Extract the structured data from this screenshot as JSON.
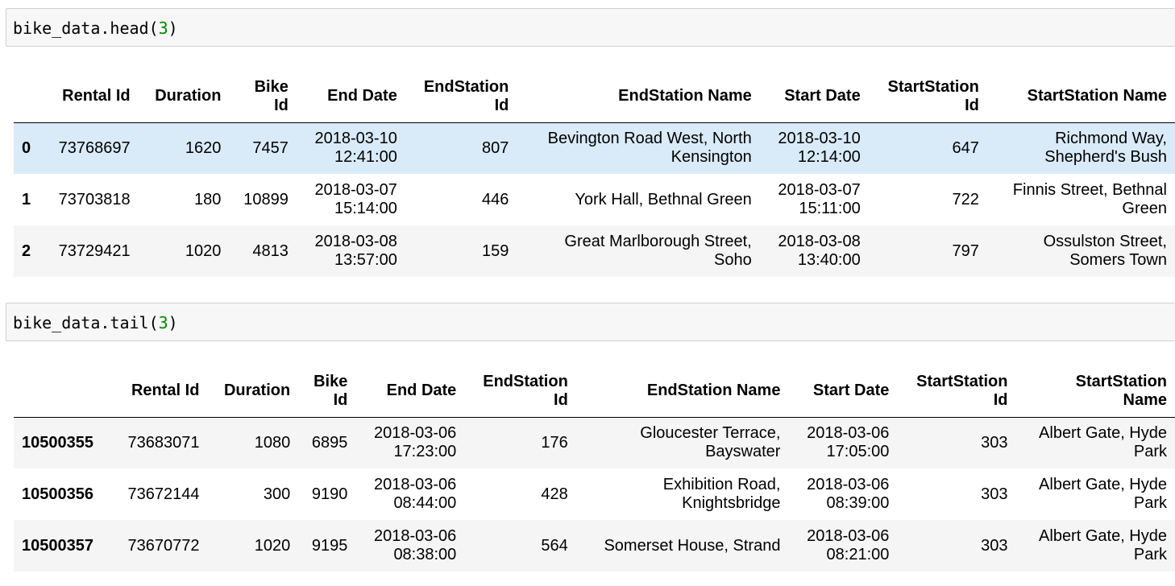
{
  "cells": [
    {
      "code_prefix": "bike_data.head(",
      "code_arg": "3",
      "code_suffix": ")",
      "columns": [
        {
          "l1": "Rental Id",
          "l2": ""
        },
        {
          "l1": "Duration",
          "l2": ""
        },
        {
          "l1": "Bike",
          "l2": "Id"
        },
        {
          "l1": "End Date",
          "l2": ""
        },
        {
          "l1": "EndStation",
          "l2": "Id"
        },
        {
          "l1": "EndStation Name",
          "l2": ""
        },
        {
          "l1": "Start Date",
          "l2": ""
        },
        {
          "l1": "StartStation",
          "l2": "Id"
        },
        {
          "l1": "StartStation Name",
          "l2": ""
        }
      ],
      "rows": [
        {
          "index": "0",
          "rental_id": "73768697",
          "duration": "1620",
          "bike_id": "7457",
          "end_date_1": "2018-03-10",
          "end_date_2": "12:41:00",
          "end_station_id": "807",
          "end_name_1": "Bevington Road West, North",
          "end_name_2": "Kensington",
          "start_date_1": "2018-03-10",
          "start_date_2": "12:14:00",
          "start_station_id": "647",
          "start_name_1": "Richmond Way,",
          "start_name_2": "Shepherd's Bush"
        },
        {
          "index": "1",
          "rental_id": "73703818",
          "duration": "180",
          "bike_id": "10899",
          "end_date_1": "2018-03-07",
          "end_date_2": "15:14:00",
          "end_station_id": "446",
          "end_name_1": "York Hall, Bethnal Green",
          "end_name_2": "",
          "start_date_1": "2018-03-07",
          "start_date_2": "15:11:00",
          "start_station_id": "722",
          "start_name_1": "Finnis Street, Bethnal",
          "start_name_2": "Green"
        },
        {
          "index": "2",
          "rental_id": "73729421",
          "duration": "1020",
          "bike_id": "4813",
          "end_date_1": "2018-03-08",
          "end_date_2": "13:57:00",
          "end_station_id": "159",
          "end_name_1": "Great Marlborough Street,",
          "end_name_2": "Soho",
          "start_date_1": "2018-03-08",
          "start_date_2": "13:40:00",
          "start_station_id": "797",
          "start_name_1": "Ossulston Street,",
          "start_name_2": "Somers Town"
        }
      ]
    },
    {
      "code_prefix": "bike_data.tail(",
      "code_arg": "3",
      "code_suffix": ")",
      "columns": [
        {
          "l1": "Rental Id",
          "l2": ""
        },
        {
          "l1": "Duration",
          "l2": ""
        },
        {
          "l1": "Bike",
          "l2": "Id"
        },
        {
          "l1": "End Date",
          "l2": ""
        },
        {
          "l1": "EndStation",
          "l2": "Id"
        },
        {
          "l1": "EndStation Name",
          "l2": ""
        },
        {
          "l1": "Start Date",
          "l2": ""
        },
        {
          "l1": "StartStation",
          "l2": "Id"
        },
        {
          "l1": "StartStation",
          "l2": "Name"
        }
      ],
      "rows": [
        {
          "index": "10500355",
          "rental_id": "73683071",
          "duration": "1080",
          "bike_id": "6895",
          "end_date_1": "2018-03-06",
          "end_date_2": "17:23:00",
          "end_station_id": "176",
          "end_name_1": "Gloucester Terrace,",
          "end_name_2": "Bayswater",
          "start_date_1": "2018-03-06",
          "start_date_2": "17:05:00",
          "start_station_id": "303",
          "start_name_1": "Albert Gate, Hyde",
          "start_name_2": "Park"
        },
        {
          "index": "10500356",
          "rental_id": "73672144",
          "duration": "300",
          "bike_id": "9190",
          "end_date_1": "2018-03-06",
          "end_date_2": "08:44:00",
          "end_station_id": "428",
          "end_name_1": "Exhibition Road,",
          "end_name_2": "Knightsbridge",
          "start_date_1": "2018-03-06",
          "start_date_2": "08:39:00",
          "start_station_id": "303",
          "start_name_1": "Albert Gate, Hyde",
          "start_name_2": "Park"
        },
        {
          "index": "10500357",
          "rental_id": "73670772",
          "duration": "1020",
          "bike_id": "9195",
          "end_date_1": "2018-03-06",
          "end_date_2": "08:38:00",
          "end_station_id": "564",
          "end_name_1": "Somerset House, Strand",
          "end_name_2": "",
          "start_date_1": "2018-03-06",
          "start_date_2": "08:21:00",
          "start_station_id": "303",
          "start_name_1": "Albert Gate, Hyde",
          "start_name_2": "Park"
        }
      ]
    }
  ]
}
